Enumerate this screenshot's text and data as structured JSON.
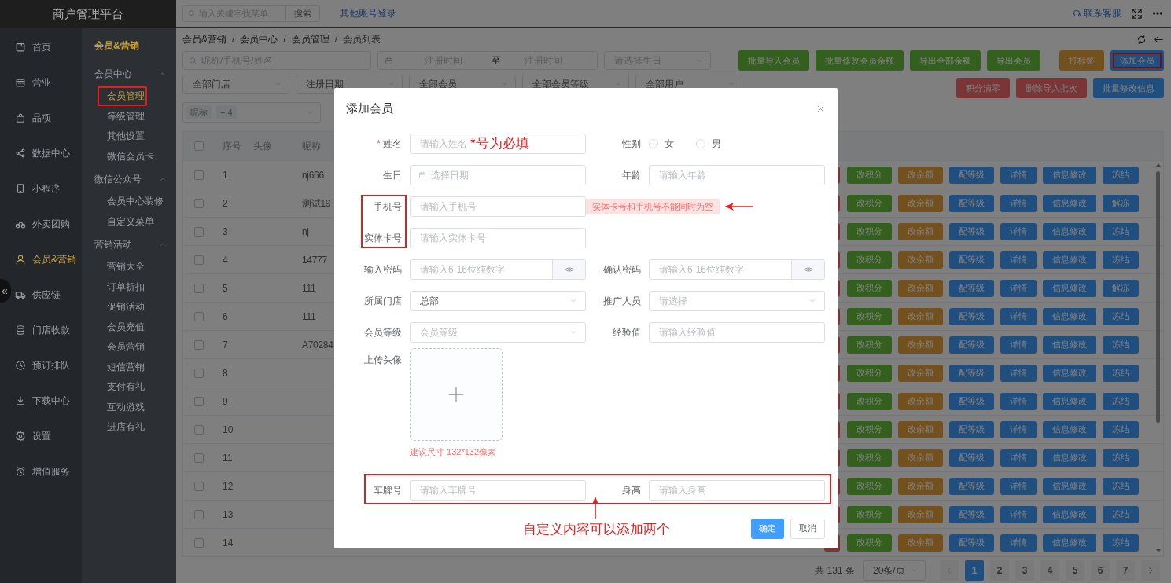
{
  "header": {
    "title": "商户管理平台",
    "search_placeholder": "输入关键字找菜单",
    "search_button": "搜索",
    "other_login": "其他账号登录",
    "support": "联系客服"
  },
  "nav": [
    {
      "label": "首页",
      "selected": false
    },
    {
      "label": "营业",
      "selected": false
    },
    {
      "label": "品项",
      "selected": false
    },
    {
      "label": "数据中心",
      "selected": false
    },
    {
      "label": "小程序",
      "selected": false
    },
    {
      "label": "外卖团购",
      "selected": false
    },
    {
      "label": "会员&营销",
      "selected": true
    },
    {
      "label": "供应链",
      "selected": false
    },
    {
      "label": "门店收款",
      "selected": false
    },
    {
      "label": "预订排队",
      "selected": false
    },
    {
      "label": "下载中心",
      "selected": false
    },
    {
      "label": "设置",
      "selected": false
    },
    {
      "label": "增值服务",
      "selected": false
    }
  ],
  "collapse_button": "«",
  "subnav": {
    "title": "会员&营销",
    "groups": [
      {
        "label": "会员中心",
        "expanded": true,
        "children": [
          {
            "label": "会员管理",
            "selected": true
          },
          {
            "label": "等级管理",
            "selected": false
          },
          {
            "label": "其他设置",
            "selected": false
          },
          {
            "label": "微信会员卡",
            "selected": false
          }
        ]
      },
      {
        "label": "微信公众号",
        "expanded": true,
        "children": [
          {
            "label": "会员中心装修",
            "selected": false
          },
          {
            "label": "自定义菜单",
            "selected": false
          }
        ]
      },
      {
        "label": "营销活动",
        "expanded": true,
        "children": [
          {
            "label": "营销大全",
            "selected": false
          },
          {
            "label": "订单折扣",
            "selected": false
          },
          {
            "label": "促销活动",
            "selected": false
          },
          {
            "label": "会员充值",
            "selected": false
          },
          {
            "label": "会员营销",
            "selected": false
          },
          {
            "label": "短信营销",
            "selected": false
          },
          {
            "label": "支付有礼",
            "selected": false
          },
          {
            "label": "互动游戏",
            "selected": false
          },
          {
            "label": "进店有礼",
            "selected": false
          }
        ]
      }
    ]
  },
  "breadcrumb": [
    {
      "label": "会员&营销"
    },
    {
      "separator": "/",
      "label": "会员中心"
    },
    {
      "separator": "/",
      "label": "会员管理"
    },
    {
      "separator": "/",
      "label": "会员列表"
    }
  ],
  "filters": {
    "search_placeholder": "昵称/手机号/姓名",
    "date_start": "注册时间",
    "date_separator": "至",
    "date_end": "注册时间",
    "birthday_placeholder": "请选择生日",
    "selects": [
      "全部门店",
      "注册日期",
      "全部会员",
      "全部会员等级",
      "全部用户"
    ],
    "tags": [
      "昵称",
      "+ 4"
    ]
  },
  "toolbar": [
    {
      "label": "批量导入会员",
      "kind": "success",
      "outlined": false
    },
    {
      "label": "批量修改会员余额",
      "kind": "success",
      "outlined": false
    },
    {
      "label": "导出全部余额",
      "kind": "success",
      "outlined": false
    },
    {
      "label": "导出会员",
      "kind": "success",
      "outlined": false
    },
    {
      "label": "打标签",
      "kind": "warning",
      "outlined": false
    },
    {
      "label": "添加会员",
      "kind": "primary",
      "outlined": true
    }
  ],
  "toolbar2": [
    {
      "label": "积分清零",
      "kind": "danger"
    },
    {
      "label": "删除导入批次",
      "kind": "danger"
    },
    {
      "label": "批量修改信息",
      "kind": "primary"
    }
  ],
  "table": {
    "columns": [
      "序号",
      "头像",
      "昵称"
    ],
    "all_checked": false,
    "rows": [
      {
        "index": "1",
        "nickname": "nj666",
        "checked": false,
        "actions": [
          {
            "label": "改积分",
            "kind": "success"
          },
          {
            "label": "改余额",
            "kind": "warning"
          },
          {
            "label": "配等级",
            "kind": "primary"
          },
          {
            "label": "详情",
            "kind": "primary"
          },
          {
            "label": "信息修改",
            "kind": "primary"
          },
          {
            "label": "冻结",
            "kind": "primary"
          }
        ]
      },
      {
        "index": "2",
        "nickname": "测试19",
        "checked": false,
        "actions": [
          {
            "label": "改积分",
            "kind": "success"
          },
          {
            "label": "改余额",
            "kind": "warning"
          },
          {
            "label": "配等级",
            "kind": "primary"
          },
          {
            "label": "详情",
            "kind": "primary"
          },
          {
            "label": "信息修改",
            "kind": "primary"
          },
          {
            "label": "解冻",
            "kind": "primary"
          }
        ]
      },
      {
        "index": "3",
        "nickname": "nj",
        "checked": false,
        "actions": [
          {
            "label": "改积分",
            "kind": "success"
          },
          {
            "label": "改余额",
            "kind": "warning"
          },
          {
            "label": "配等级",
            "kind": "primary"
          },
          {
            "label": "详情",
            "kind": "primary"
          },
          {
            "label": "信息修改",
            "kind": "primary"
          },
          {
            "label": "冻结",
            "kind": "primary"
          }
        ]
      },
      {
        "index": "4",
        "nickname": "14777",
        "checked": false,
        "actions": [
          {
            "label": "改积分",
            "kind": "success"
          },
          {
            "label": "改余额",
            "kind": "warning"
          },
          {
            "label": "配等级",
            "kind": "primary"
          },
          {
            "label": "详情",
            "kind": "primary"
          },
          {
            "label": "信息修改",
            "kind": "primary"
          },
          {
            "label": "冻结",
            "kind": "primary"
          }
        ]
      },
      {
        "index": "5",
        "nickname": "111",
        "checked": false,
        "actions": [
          {
            "label": "改积分",
            "kind": "success"
          },
          {
            "label": "改余额",
            "kind": "warning"
          },
          {
            "label": "配等级",
            "kind": "primary"
          },
          {
            "label": "详情",
            "kind": "primary"
          },
          {
            "label": "信息修改",
            "kind": "primary"
          },
          {
            "label": "解冻",
            "kind": "primary"
          }
        ]
      },
      {
        "index": "6",
        "nickname": "111",
        "checked": false,
        "actions": [
          {
            "label": "改积分",
            "kind": "success"
          },
          {
            "label": "改余额",
            "kind": "warning"
          },
          {
            "label": "配等级",
            "kind": "primary"
          },
          {
            "label": "详情",
            "kind": "primary"
          },
          {
            "label": "信息修改",
            "kind": "primary"
          },
          {
            "label": "冻结",
            "kind": "primary"
          }
        ]
      },
      {
        "index": "7",
        "nickname": "A70284",
        "checked": false,
        "actions": [
          {
            "label": "改积分",
            "kind": "success"
          },
          {
            "label": "改余额",
            "kind": "warning"
          },
          {
            "label": "配等级",
            "kind": "primary"
          },
          {
            "label": "详情",
            "kind": "primary"
          },
          {
            "label": "信息修改",
            "kind": "primary"
          },
          {
            "label": "冻结",
            "kind": "primary"
          }
        ]
      },
      {
        "index": "8",
        "checked": false,
        "actions": [
          {
            "label": "改积分",
            "kind": "success"
          },
          {
            "label": "改余额",
            "kind": "warning"
          },
          {
            "label": "配等级",
            "kind": "primary"
          },
          {
            "label": "详情",
            "kind": "primary"
          },
          {
            "label": "信息修改",
            "kind": "primary"
          },
          {
            "label": "冻结",
            "kind": "primary"
          }
        ]
      },
      {
        "index": "9",
        "checked": false,
        "actions": [
          {
            "label": "改积分",
            "kind": "success"
          },
          {
            "label": "改余额",
            "kind": "warning"
          },
          {
            "label": "配等级",
            "kind": "primary"
          },
          {
            "label": "详情",
            "kind": "primary"
          },
          {
            "label": "信息修改",
            "kind": "primary"
          },
          {
            "label": "冻结",
            "kind": "primary"
          }
        ]
      },
      {
        "index": "10",
        "checked": false,
        "actions": [
          {
            "label": "改积分",
            "kind": "success"
          },
          {
            "label": "改余额",
            "kind": "warning"
          },
          {
            "label": "配等级",
            "kind": "primary"
          },
          {
            "label": "详情",
            "kind": "primary"
          },
          {
            "label": "信息修改",
            "kind": "primary"
          },
          {
            "label": "冻结",
            "kind": "primary"
          }
        ]
      },
      {
        "index": "11",
        "checked": false,
        "actions": [
          {
            "label": "改积分",
            "kind": "success"
          },
          {
            "label": "改余额",
            "kind": "warning"
          },
          {
            "label": "配等级",
            "kind": "primary"
          },
          {
            "label": "详情",
            "kind": "primary"
          },
          {
            "label": "信息修改",
            "kind": "primary"
          },
          {
            "label": "冻结",
            "kind": "primary"
          }
        ]
      },
      {
        "index": "12",
        "checked": false,
        "actions": [
          {
            "label": "改积分",
            "kind": "success"
          },
          {
            "label": "改余额",
            "kind": "warning"
          },
          {
            "label": "配等级",
            "kind": "primary"
          },
          {
            "label": "详情",
            "kind": "primary"
          },
          {
            "label": "信息修改",
            "kind": "primary"
          },
          {
            "label": "冻结",
            "kind": "primary"
          }
        ]
      },
      {
        "index": "13",
        "checked": false,
        "actions": [
          {
            "label": "改积分",
            "kind": "success"
          },
          {
            "label": "改余额",
            "kind": "warning"
          },
          {
            "label": "配等级",
            "kind": "primary"
          },
          {
            "label": "详情",
            "kind": "primary"
          },
          {
            "label": "信息修改",
            "kind": "primary"
          },
          {
            "label": "冻结",
            "kind": "primary"
          }
        ]
      },
      {
        "index": "14",
        "checked": false,
        "actions": [
          {
            "label": "改积分",
            "kind": "success"
          },
          {
            "label": "改余额",
            "kind": "warning"
          },
          {
            "label": "配等级",
            "kind": "primary"
          },
          {
            "label": "详情",
            "kind": "primary"
          },
          {
            "label": "信息修改",
            "kind": "primary"
          },
          {
            "label": "冻结",
            "kind": "primary"
          }
        ]
      }
    ]
  },
  "pagination": {
    "total": "共 131 条",
    "page_size": "20条/页",
    "pages": [
      {
        "label": "1",
        "selected": true
      },
      {
        "label": "2",
        "selected": false
      },
      {
        "label": "3",
        "selected": false
      },
      {
        "label": "4",
        "selected": false
      },
      {
        "label": "5",
        "selected": false
      },
      {
        "label": "6",
        "selected": false
      },
      {
        "label": "7",
        "selected": false
      }
    ]
  },
  "modal": {
    "title": "添加会员",
    "required_mark": "*",
    "rows": [
      {
        "cells": [
          {
            "kind": "text",
            "label": "姓名",
            "required": true,
            "placeholder": "请输入姓名"
          },
          {
            "kind": "radio",
            "label": "性别",
            "options": [
              {
                "label": "女",
                "selected": false
              },
              {
                "label": "男",
                "selected": false
              }
            ]
          }
        ]
      },
      {
        "cells": [
          {
            "kind": "date",
            "label": "生日",
            "required": false,
            "placeholder": "选择日期"
          },
          {
            "kind": "text",
            "label": "年龄",
            "required": false,
            "placeholder": "请输入年龄"
          }
        ]
      },
      {
        "cells": [
          {
            "kind": "text",
            "label": "手机号",
            "required": false,
            "placeholder": "请输入手机号"
          },
          {
            "kind": "error",
            "text": "实体卡号和手机号不能同时为空"
          }
        ]
      },
      {
        "cells": [
          {
            "kind": "text",
            "label": "实体卡号",
            "required": false,
            "placeholder": "请输入实体卡号"
          }
        ]
      },
      {
        "cells": [
          {
            "kind": "password",
            "label": "输入密码",
            "required": false,
            "placeholder": "请输入6-16位纯数字"
          },
          {
            "kind": "password",
            "label": "确认密码",
            "required": false,
            "placeholder": "请输入6-16位纯数字"
          }
        ]
      },
      {
        "cells": [
          {
            "kind": "select",
            "label": "所属门店",
            "required": false,
            "value": "总部"
          },
          {
            "kind": "select",
            "label": "推广人员",
            "required": false,
            "placeholder": "请选择"
          }
        ]
      },
      {
        "cells": [
          {
            "kind": "select",
            "label": "会员等级",
            "required": false,
            "placeholder": "会员等级"
          },
          {
            "kind": "text",
            "label": "经验值",
            "required": false,
            "placeholder": "请输入经验值"
          }
        ]
      }
    ],
    "upload": {
      "label": "上传头像",
      "hint": "建议尺寸 132*132像素"
    },
    "custom_fields": [
      {
        "label": "车牌号",
        "placeholder": "请输入车牌号"
      },
      {
        "label": "身高",
        "placeholder": "请输入身高"
      }
    ],
    "confirm": "确定",
    "cancel": "取消"
  },
  "annotations": {
    "required_note": "*号为必填",
    "custom_note": "自定义内容可以添加两个"
  }
}
